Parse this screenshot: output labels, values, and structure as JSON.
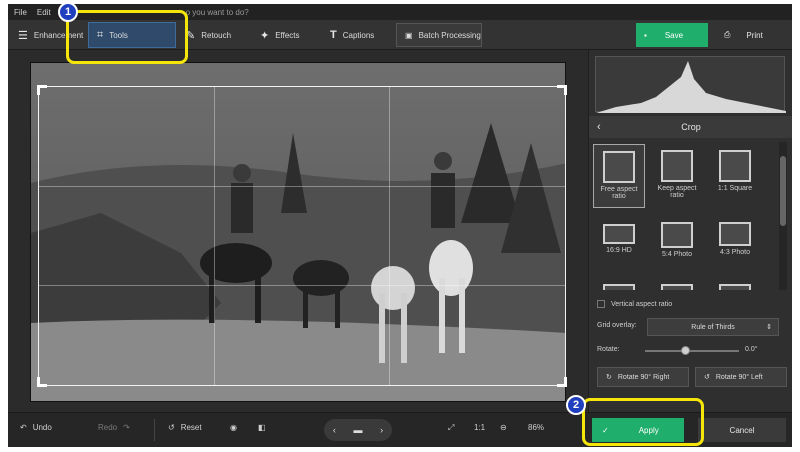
{
  "menu": {
    "items": [
      "File",
      "Edit",
      "T"
    ],
    "hint": "o you want to do?"
  },
  "toolbar": {
    "tabs": [
      {
        "label": "Enhancement",
        "icon": "sliders-icon"
      },
      {
        "label": "Tools",
        "icon": "crop-icon"
      },
      {
        "label": "Retouch",
        "icon": "brush-icon"
      },
      {
        "label": "Effects",
        "icon": "magic-wand-icon"
      },
      {
        "label": "Captions",
        "icon": "text-icon"
      }
    ],
    "batch_label": "Batch Processing",
    "save_label": "Save",
    "print_label": "Print"
  },
  "panel": {
    "crop_title": "Crop",
    "presets": [
      {
        "label": "Free aspect ratio"
      },
      {
        "label": "Keep aspect ratio"
      },
      {
        "label": "1:1 Square"
      },
      {
        "label": "16:9 HD"
      },
      {
        "label": "5:4 Photo"
      },
      {
        "label": "4:3 Photo"
      }
    ],
    "vertical_aspect_label": "Vertical aspect ratio",
    "grid_overlay_label": "Grid overlay:",
    "grid_overlay_value": "Rule of Thirds",
    "rotate_label": "Rotate:",
    "rotate_value": "0.0°",
    "rotate_right_label": "Rotate 90° Right",
    "rotate_left_label": "Rotate 90° Left"
  },
  "bottom": {
    "undo_label": "Undo",
    "redo_label": "Redo",
    "reset_label": "Reset",
    "ratio_label": "1:1",
    "zoom_value": "86%",
    "apply_label": "Apply",
    "cancel_label": "Cancel"
  },
  "annotations": {
    "badge1": "1",
    "badge2": "2",
    "highlight_color": "#f5e50a",
    "badge_color": "#1f3fbf"
  },
  "colors": {
    "accent_green": "#1fae6b",
    "active_tab": "#2f4a6b"
  }
}
